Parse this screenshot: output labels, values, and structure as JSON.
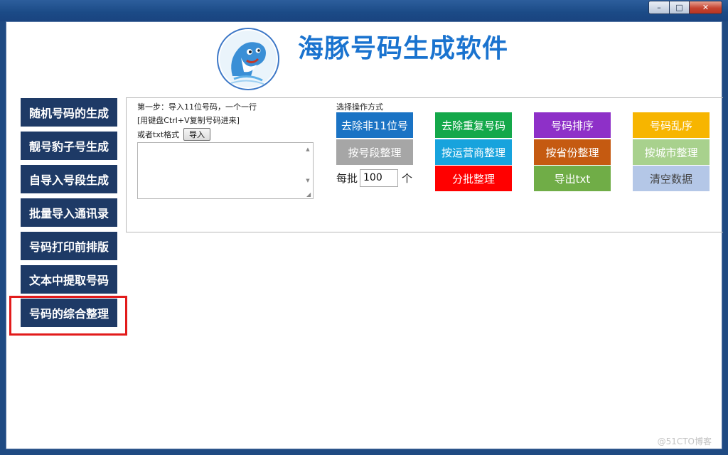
{
  "window": {
    "controls": {
      "minimize": "–",
      "maximize": "□",
      "close": "✕"
    }
  },
  "header": {
    "title": "海豚号码生成软件",
    "logo_icon": "dolphin-logo"
  },
  "sidebar": {
    "items": [
      {
        "label": "随机号码的生成"
      },
      {
        "label": "靓号豹子号生成"
      },
      {
        "label": "自导入号段生成"
      },
      {
        "label": "批量导入通讯录"
      },
      {
        "label": "号码打印前排版"
      },
      {
        "label": "文本中提取号码"
      },
      {
        "label": "号码的综合整理",
        "highlighted": true
      }
    ],
    "highlight_color": "#e21b1b"
  },
  "import_section": {
    "step_text": "第一步：导入11位号码，一个一行",
    "paste_hint": "[用键盘Ctrl+V复制号码进来]",
    "txt_label": "或者txt格式",
    "import_button": "导入",
    "textarea_value": ""
  },
  "operations": {
    "label": "选择操作方式",
    "buttons": [
      {
        "label": "去除非11位号",
        "color": "#1a73c4"
      },
      {
        "label": "去除重复号码",
        "color": "#14a84a"
      },
      {
        "label": "号码排序",
        "color": "#8e30c8"
      },
      {
        "label": "号码乱序",
        "color": "#f7b500"
      },
      {
        "label": "按号段整理",
        "color": "#a6a6a6"
      },
      {
        "label": "按运营商整理",
        "color": "#17a3dd"
      },
      {
        "label": "按省份整理",
        "color": "#c55a11"
      },
      {
        "label": "按城市整理",
        "color": "#a8d18d"
      },
      {
        "label": "分批整理",
        "color": "#ff0000"
      },
      {
        "label": "导出txt",
        "color": "#70ad47"
      },
      {
        "label": "清空数据",
        "color": "#b4c7e7"
      }
    ],
    "batch_prefix": "每批",
    "batch_value": "100",
    "batch_suffix": "个"
  },
  "watermark": "@51CTO博客"
}
